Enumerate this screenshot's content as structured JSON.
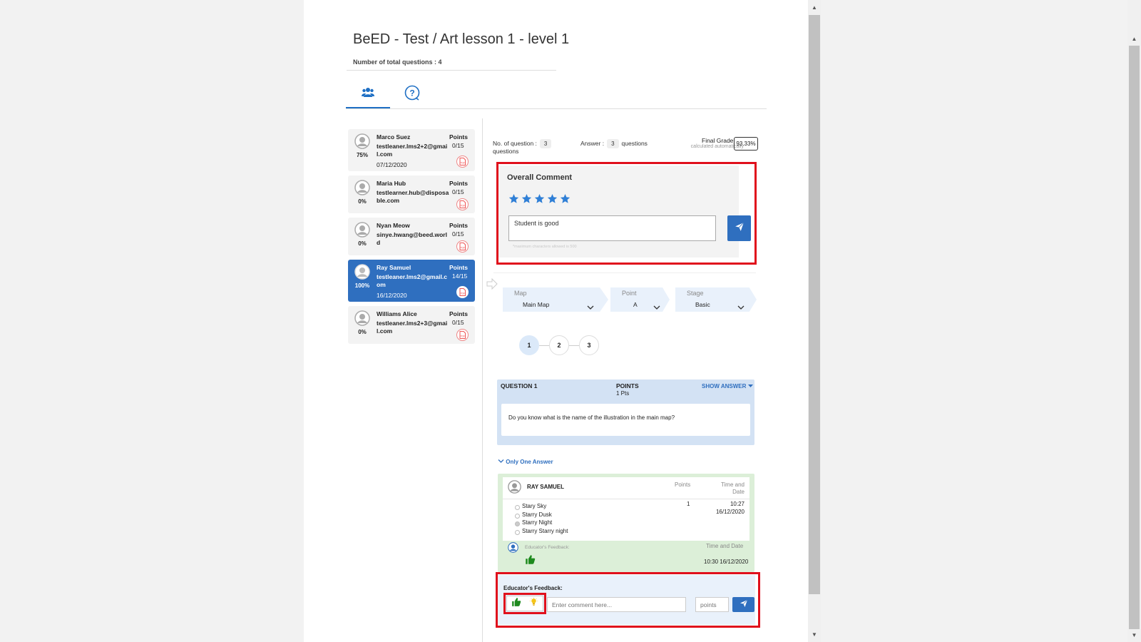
{
  "header": {
    "title": "BeED - Test / Art lesson 1 - level 1",
    "total_questions": "Number of total questions : 4"
  },
  "tabs": [
    {
      "icon": "users-icon",
      "active": true
    },
    {
      "icon": "question-icon",
      "active": false
    }
  ],
  "students": [
    {
      "name": "Marco Suez",
      "email": "testleaner.lms2+2@gmail.com",
      "date": "07/12/2020",
      "percent": "75%",
      "points_label": "Points",
      "points": "0/15",
      "selected": false
    },
    {
      "name": "Maria Hub",
      "email": "testlearner.hub@disposable.com",
      "date": "",
      "percent": "0%",
      "points_label": "Points",
      "points": "0/15",
      "selected": false
    },
    {
      "name": "Nyan Meow",
      "email": "sinye.hwang@beed.world",
      "date": "",
      "percent": "0%",
      "points_label": "Points",
      "points": "0/15",
      "selected": false
    },
    {
      "name": "Ray Samuel",
      "email": "testleaner.lms2@gmail.com",
      "date": "16/12/2020",
      "percent": "100%",
      "points_label": "Points",
      "points": "14/15",
      "selected": true
    },
    {
      "name": "Williams Alice",
      "email": "testleaner.lms2+3@gmail.com",
      "date": "",
      "percent": "0%",
      "points_label": "Points",
      "points": "0/15",
      "selected": false
    }
  ],
  "summary": {
    "no_of_question_label": "No. of question :",
    "no_of_question_value": "3",
    "questions_word": "questions",
    "answer_label": "Answer :",
    "answer_value": "3",
    "answer_suffix": "questions",
    "final_grade_label": "Final Grade",
    "final_grade_sub": "calculated automatically",
    "final_grade_value": "93.33%"
  },
  "overall_comment": {
    "title": "Overall Comment",
    "stars": 5,
    "comment": "Student is good",
    "hint": "*maximum characters allowed is 500"
  },
  "filters": {
    "map_label": "Map",
    "map_value": "Main Map",
    "point_label": "Point",
    "point_value": "A",
    "stage_label": "Stage",
    "stage_value": "Basic"
  },
  "steps": [
    "1",
    "2",
    "3"
  ],
  "question": {
    "label": "QUESTION 1",
    "points_label": "POINTS",
    "points_value": "1 Pts",
    "show_answer": "SHOW ANSWER",
    "text": "Do you know what is the name of the illustration in the main map?",
    "type": "Only One Answer"
  },
  "answer": {
    "student": "RAY SAMUEL",
    "points_header": "Points",
    "time_header_1": "Time and",
    "time_header_2": "Date",
    "options": [
      {
        "text": "Stary Sky",
        "selected": false
      },
      {
        "text": "Starry Dusk",
        "selected": false
      },
      {
        "text": "Starry Night",
        "selected": true
      },
      {
        "text": "Starry Starry night",
        "selected": false
      }
    ],
    "points": "1",
    "time": "10:27",
    "date": "16/12/2020",
    "educator_feedback_label": "Educator's Feedback:",
    "feedback_time_label": "Time and Date",
    "feedback_time_value": "10:30 16/12/2020"
  },
  "feedback_form": {
    "label": "Educator's Feedback:",
    "comment_placeholder": "Enter comment here...",
    "points_placeholder": "points"
  },
  "colors": {
    "accent": "#2f6fbf",
    "highlight_border": "#e0101c",
    "thumbs_up": "#1e8a1e",
    "star": "#2f7fd6"
  }
}
